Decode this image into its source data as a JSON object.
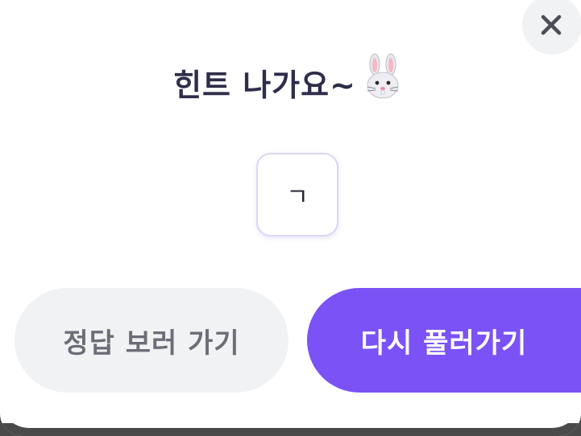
{
  "dialog": {
    "title": "힌트 나가요~",
    "title_emoji": "rabbit-face",
    "hint_text": "ㄱ",
    "close_icon": "close-icon"
  },
  "buttons": {
    "answer_label": "정답 보러 가기",
    "retry_label": "다시 풀러가기"
  },
  "colors": {
    "accent": "#7b52f5",
    "title_text": "#2e2d4a",
    "secondary_button_bg": "#f1f2f4",
    "secondary_button_text": "#6b6e77",
    "hint_border": "#dcd6f7"
  }
}
